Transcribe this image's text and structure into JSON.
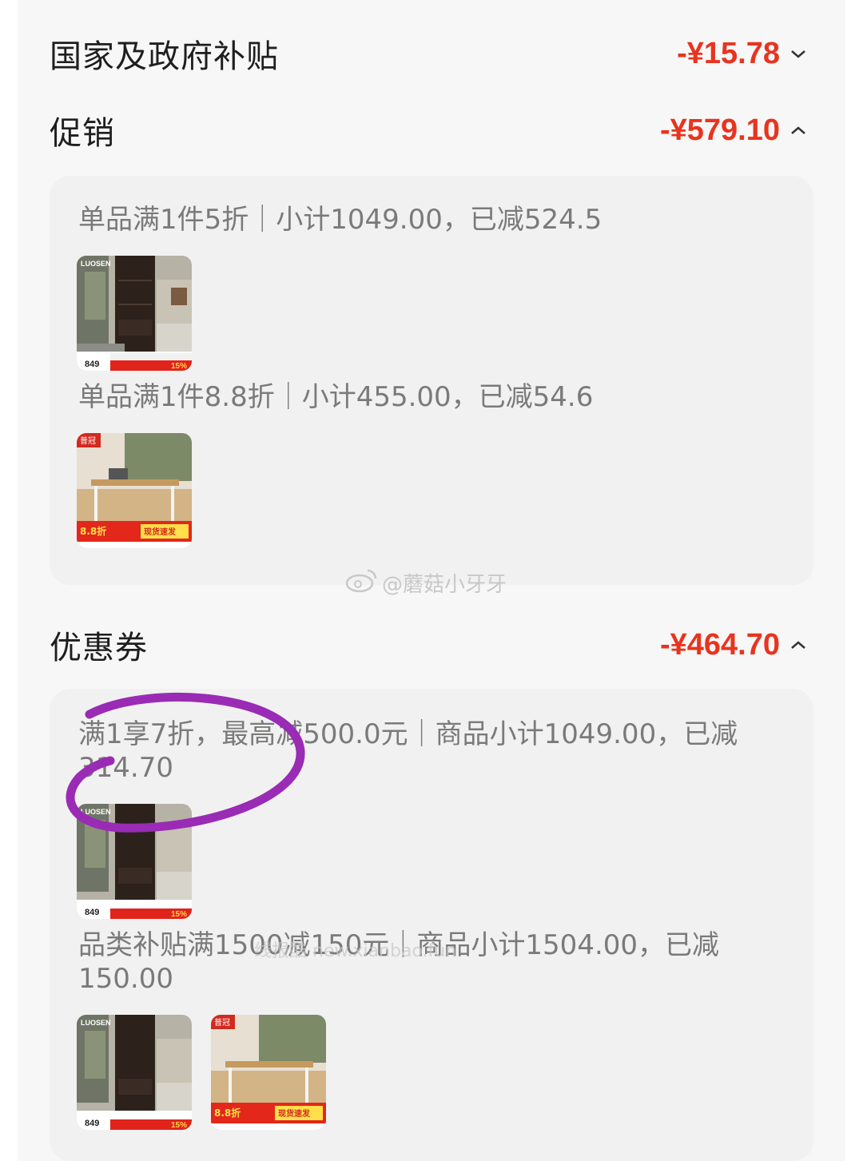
{
  "rows": {
    "subsidy": {
      "title": "国家及政府补贴",
      "amount": "-¥15.78",
      "chevron": "chevron-down-icon"
    },
    "promotion": {
      "title": "促销",
      "amount": "-¥579.10",
      "chevron": "chevron-up-icon"
    },
    "coupon": {
      "title": "优惠券",
      "amount": "-¥464.70",
      "chevron": "chevron-up-icon"
    }
  },
  "promotion_card": {
    "items": [
      {
        "desc": "单品满1件5折｜小计1049.00，已减524.5",
        "product": {
          "brand": "LUOSEN",
          "price": "849",
          "badge": "15%"
        }
      },
      {
        "desc": "单品满1件8.8折｜小计455.00，已减54.6",
        "product": {
          "brand": "普冠",
          "badge": "8.8折",
          "promo": "现货速发"
        }
      }
    ]
  },
  "coupon_card": {
    "items": [
      {
        "desc": "满1享7折，最高减500.0元｜商品小计1049.00，已减314.70"
      },
      {
        "desc": "品类补贴满1500减150元｜商品小计1504.00，已减150.00"
      }
    ]
  },
  "watermark": {
    "text": "@蘑菇小牙牙",
    "icon": "weibo-icon"
  },
  "watermark2": {
    "text": "线报酷 new.xianbao.fun"
  },
  "colors": {
    "accent": "#e8341f",
    "annotation": "#9a2bb5"
  }
}
